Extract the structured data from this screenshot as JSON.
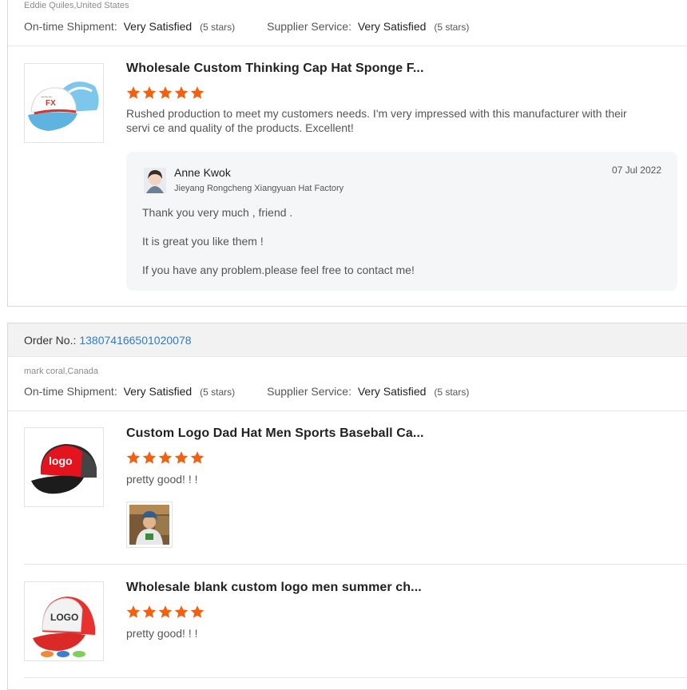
{
  "reviews": [
    {
      "buyer": "Eddie Quiles,United States",
      "shipment_label": "On-time Shipment:",
      "shipment_value": "Very Satisfied",
      "shipment_stars": "(5 stars)",
      "service_label": "Supplier Service:",
      "service_value": "Very Satisfied",
      "service_stars": "(5 stars)",
      "items": [
        {
          "title": "Wholesale Custom Thinking Cap Hat Sponge F...",
          "rating": 5,
          "text": "Rushed production to meet my customers needs. I'm very impressed with this manufacturer with their servi ce and quality of the products. Excellent!",
          "reply": {
            "name": "Anne Kwok",
            "company": "Jieyang Rongcheng Xiangyuan Hat Factory",
            "date": "07 Jul 2022",
            "lines": [
              "Thank you very much , friend .",
              "It is great you like them !",
              "If you have any problem.please feel free to contact  me!"
            ]
          }
        }
      ]
    },
    {
      "order_label": "Order No.:",
      "order_number": "138074166501020078",
      "buyer": "mark coral,Canada",
      "shipment_label": "On-time Shipment:",
      "shipment_value": "Very Satisfied",
      "shipment_stars": "(5 stars)",
      "service_label": "Supplier Service:",
      "service_value": "Very Satisfied",
      "service_stars": "(5 stars)",
      "items": [
        {
          "title": "Custom Logo Dad Hat Men Sports Baseball Ca...",
          "rating": 5,
          "text": "pretty good!  !  !",
          "thumb_text": "logo"
        },
        {
          "title": "Wholesale blank custom logo men summer ch...",
          "rating": 5,
          "text": "pretty good!  !  !",
          "thumb_text": "LOGO"
        }
      ]
    }
  ],
  "colors": {
    "star": "#f3600f",
    "link": "#2f7bc5",
    "reply_bg": "#f5f6f8"
  }
}
